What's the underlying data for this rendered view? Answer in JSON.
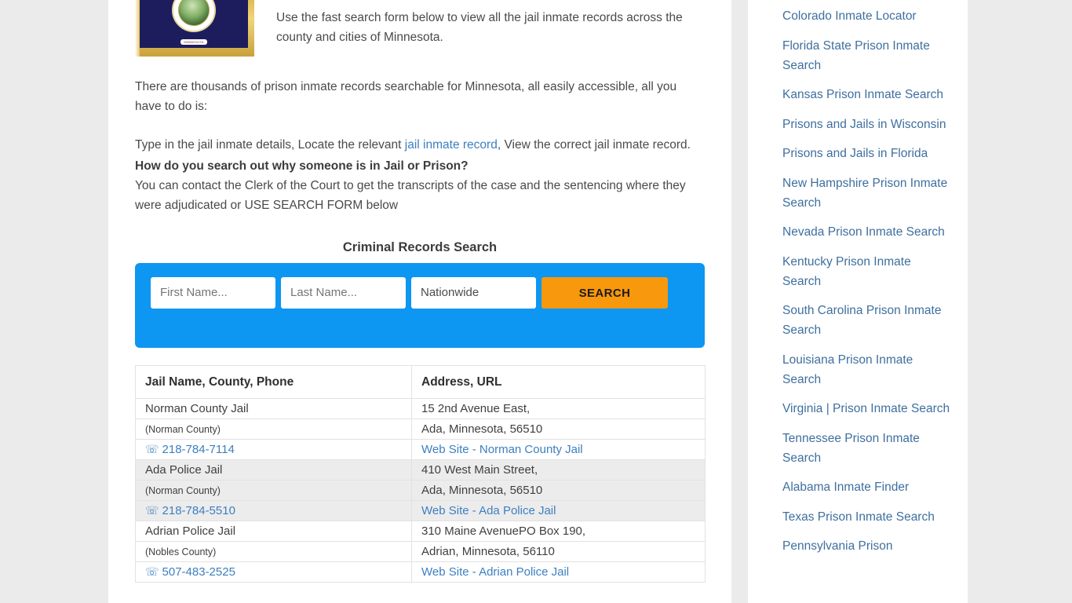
{
  "intro": {
    "flag_alt": "Minnesota state flag",
    "flag_seal_text": "MINNESOTA",
    "lead": "Use the fast search form below to view all the jail inmate records across the county and cities of Minnesota.",
    "paragraph_1": "There are thousands of prison inmate records searchable for Minnesota, all easily accessible, all you have to do is:",
    "paragraph_2_before": "Type in the jail inmate details, Locate the relevant ",
    "paragraph_2_link": "jail inmate record",
    "paragraph_2_after": ", View the correct jail inmate record.",
    "question": "How do you search out why someone is in Jail or Prison?",
    "answer": "You can contact the Clerk of the Court to get the transcripts of the case and the sentencing where they were adjudicated or USE SEARCH FORM below"
  },
  "search": {
    "heading": "Criminal Records Search",
    "first_name_placeholder": "First Name...",
    "first_name_value": "",
    "last_name_placeholder": "Last Name...",
    "last_name_value": "",
    "state_selected": "Nationwide",
    "submit_label": "SEARCH",
    "box_color": "#0d96f2",
    "button_color": "#f8980c"
  },
  "table": {
    "headers": [
      "Jail Name, County, Phone",
      "Address, URL"
    ],
    "phone_icon": "☏",
    "rows": [
      {
        "shade": false,
        "name": "Norman County Jail",
        "county": "(Norman County)",
        "phone": "218-784-7114",
        "address_line1": "15 2nd Avenue East,",
        "address_line2": "Ada, Minnesota, 56510",
        "website": "Web Site - Norman County Jail"
      },
      {
        "shade": true,
        "name": "Ada Police Jail",
        "county": "(Norman County)",
        "phone": "218-784-5510",
        "address_line1": "410 West Main Street,",
        "address_line2": "Ada, Minnesota, 56510",
        "website": "Web Site - Ada Police Jail"
      },
      {
        "shade": false,
        "name": "Adrian Police Jail",
        "county": "(Nobles County)",
        "phone": "507-483-2525",
        "address_line1": "310 Maine AvenuePO Box 190,",
        "address_line2": "Adrian, Minnesota, 56110",
        "website": "Web Site - Adrian Police Jail"
      }
    ]
  },
  "sidebar": {
    "links": [
      "Colorado Inmate Locator",
      "Florida State Prison Inmate Search",
      "Kansas Prison Inmate Search",
      "Prisons and Jails in Wisconsin",
      "Prisons and Jails in Florida",
      "New Hampshire Prison Inmate Search",
      "Nevada Prison Inmate Search",
      "Kentucky Prison Inmate Search",
      "South Carolina Prison Inmate Search",
      "Louisiana Prison Inmate Search",
      "Virginia | Prison Inmate Search",
      "Tennessee Prison Inmate Search",
      "Alabama Inmate Finder",
      "Texas Prison Inmate Search",
      "Pennsylvania Prison"
    ]
  }
}
